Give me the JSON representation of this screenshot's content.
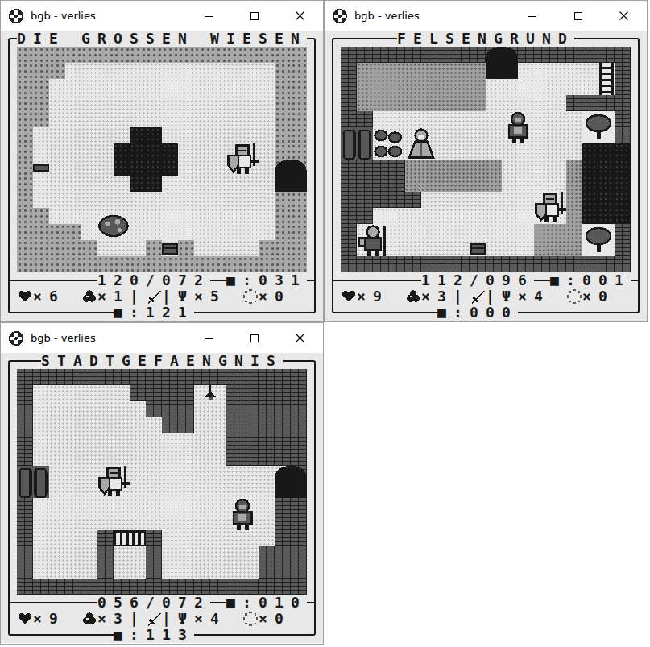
{
  "windows": [
    {
      "title": "bgb - verlies",
      "screen": {
        "location": "DIE GROSSEN WIESEN",
        "hud": {
          "position": "120/072",
          "counter_top": "■:031",
          "hearts": "×6",
          "bombs": "×1",
          "divider_left": "|",
          "divider_right": "|",
          "magic": "Ψ×5",
          "stars": "×0",
          "counter_bottom": "■:121"
        }
      }
    },
    {
      "title": "bgb - verlies",
      "screen": {
        "location": "FELSENGRUND",
        "hud": {
          "position": "112/096",
          "counter_top": "■:001",
          "hearts": "×9",
          "bombs": "×3",
          "divider_left": "|",
          "divider_right": "|",
          "magic": "Ψ×4",
          "stars": "×0",
          "counter_bottom": "■:000"
        }
      }
    },
    {
      "title": "bgb - verlies",
      "screen": {
        "location": "STADTGEFAENGNIS",
        "hud": {
          "position": "056/072",
          "counter_top": "■:010",
          "hearts": "×9",
          "bombs": "×3",
          "divider_left": "|",
          "divider_right": "|",
          "magic": "Ψ×4",
          "stars": "×0",
          "counter_bottom": "■:113"
        }
      }
    }
  ]
}
